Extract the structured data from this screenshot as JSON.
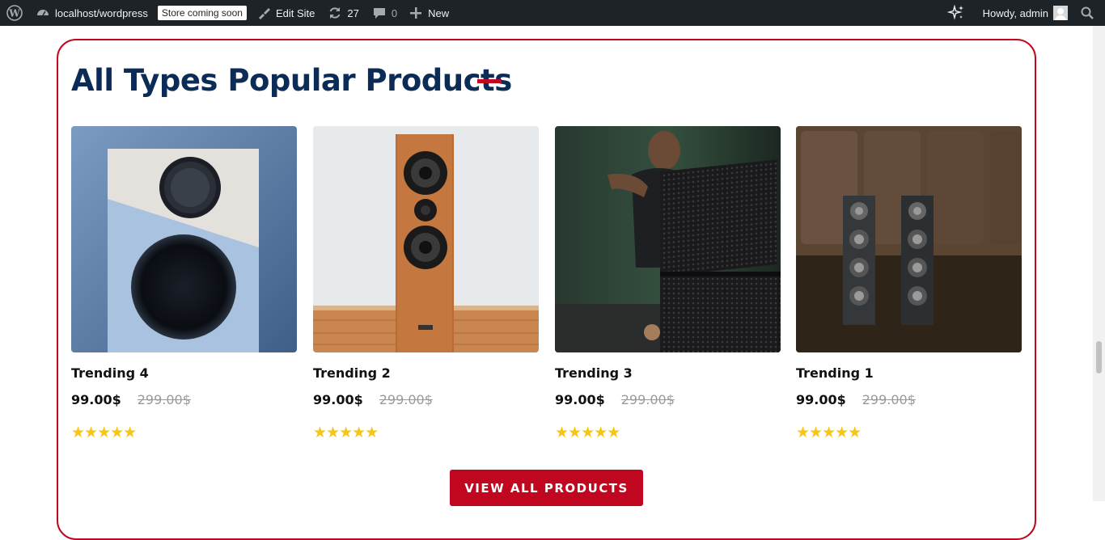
{
  "adminbar": {
    "site_name": "localhost/wordpress",
    "store_badge": "Store coming soon",
    "edit_site": "Edit Site",
    "updates_count": "27",
    "comments_count": "0",
    "new_label": "New",
    "howdy": "Howdy, admin",
    "icons": [
      "wordpress-logo-icon",
      "dashboard-icon",
      "brush-icon",
      "updates-icon",
      "comment-icon",
      "plus-icon",
      "sparkle-icon",
      "search-icon"
    ]
  },
  "section": {
    "heading": "All Types Popular Products",
    "accent_color": "#c1071f",
    "heading_color": "#0b2c57"
  },
  "products": [
    {
      "title": "Trending 4",
      "price": "99.00$",
      "old_price": "299.00$",
      "stars": "★★★★★",
      "rating": 5
    },
    {
      "title": "Trending 2",
      "price": "99.00$",
      "old_price": "299.00$",
      "stars": "★★★★★",
      "rating": 5
    },
    {
      "title": "Trending 3",
      "price": "99.00$",
      "old_price": "299.00$",
      "stars": "★★★★★",
      "rating": 5
    },
    {
      "title": "Trending 1",
      "price": "99.00$",
      "old_price": "299.00$",
      "stars": "★★★★★",
      "rating": 5
    }
  ],
  "cta": {
    "label": "VIEW ALL PRODUCTS"
  }
}
